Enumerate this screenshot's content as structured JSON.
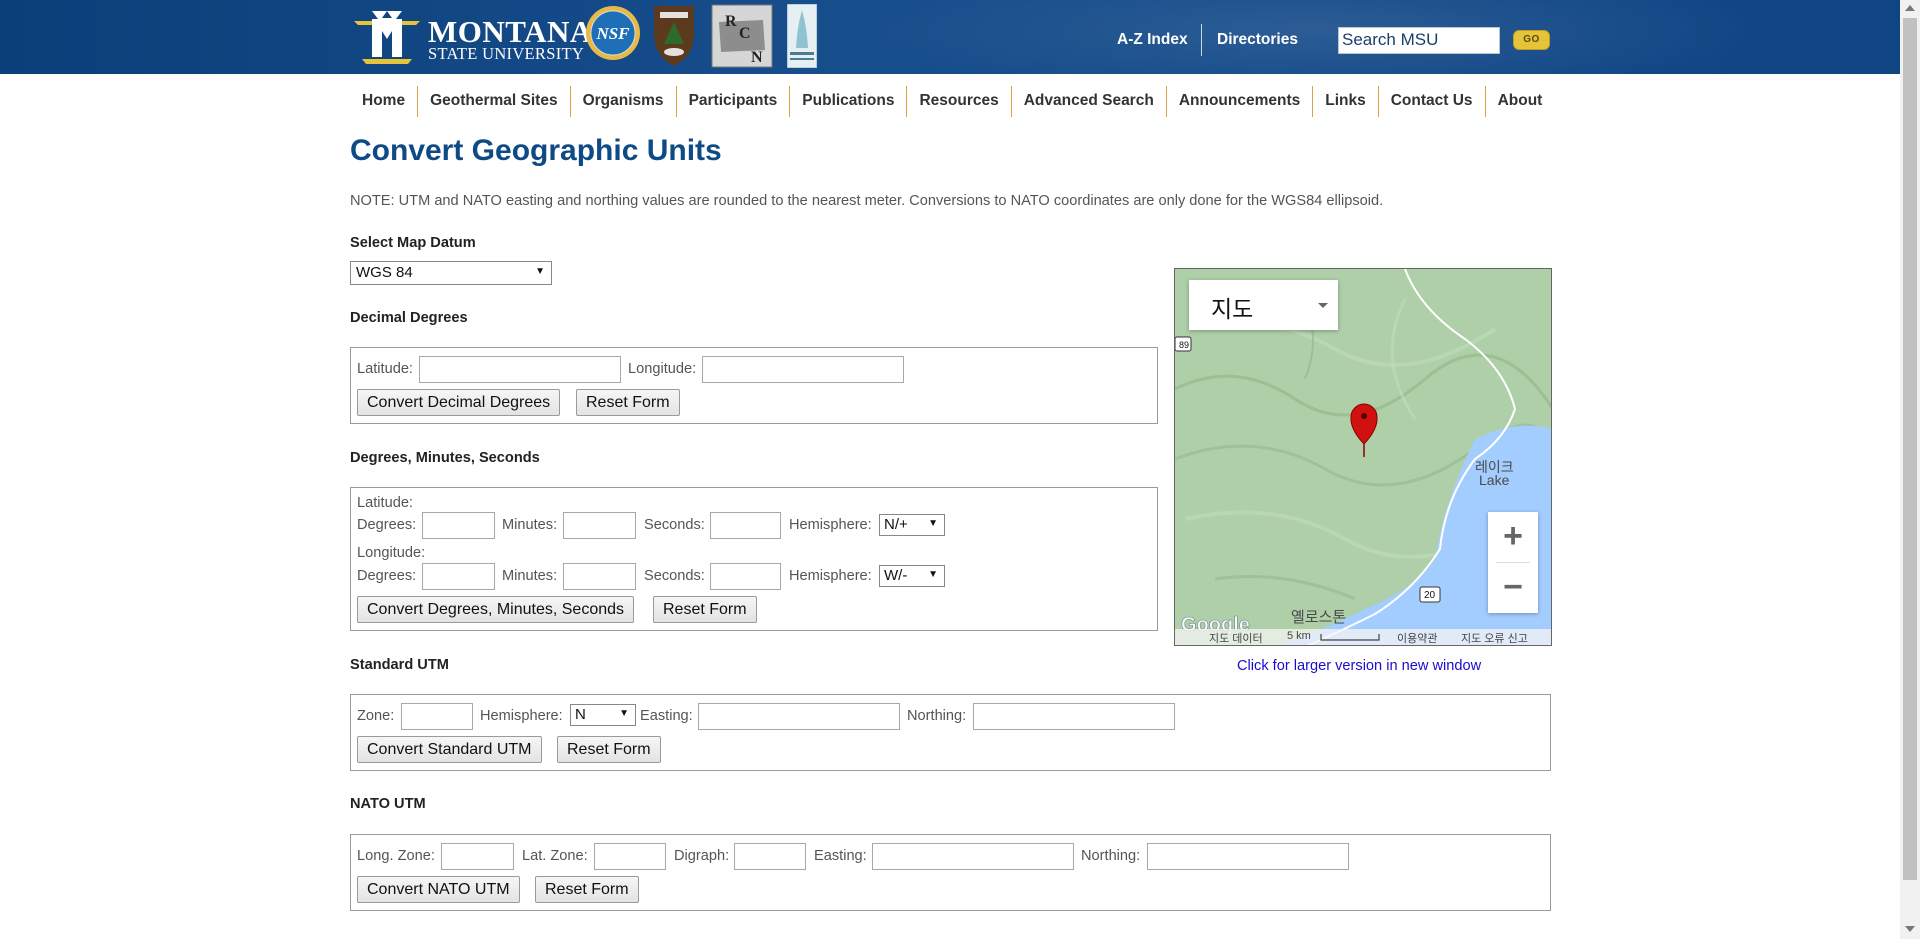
{
  "header": {
    "logo_line1": "MONTANA",
    "logo_line2": "STATE UNIVERSITY",
    "nsf_label": "NSF",
    "links": {
      "az": "A-Z Index",
      "directories": "Directories"
    },
    "search": {
      "value": "Search MSU",
      "go": "GO"
    },
    "colors": {
      "band": "#0b3f7a",
      "gold": "#e5c43a"
    }
  },
  "nav": {
    "items": [
      "Home",
      "Geothermal Sites",
      "Organisms",
      "Participants",
      "Publications",
      "Resources",
      "Advanced Search",
      "Announcements",
      "Links",
      "Contact Us",
      "About"
    ]
  },
  "page": {
    "title": "Convert Geographic Units",
    "note": "NOTE: UTM and NATO easting and northing values are rounded to the nearest meter. Conversions to NATO coordinates are only done for the WGS84 ellipsoid."
  },
  "datum": {
    "label": "Select Map Datum",
    "selected": "WGS 84"
  },
  "decimal": {
    "heading": "Decimal Degrees",
    "latitude_label": "Latitude:",
    "longitude_label": "Longitude:",
    "convert": "Convert Decimal Degrees",
    "reset": "Reset Form"
  },
  "dms": {
    "heading": "Degrees, Minutes, Seconds",
    "latitude_label": "Latitude:",
    "longitude_label": "Longitude:",
    "degrees_label": "Degrees:",
    "minutes_label": "Minutes:",
    "seconds_label": "Seconds:",
    "hemisphere_label": "Hemisphere:",
    "lat_hemisphere": "N/+",
    "lon_hemisphere": "W/-",
    "convert": "Convert Degrees, Minutes, Seconds",
    "reset": "Reset Form"
  },
  "utm": {
    "heading": "Standard UTM",
    "zone_label": "Zone:",
    "hemisphere_label": "Hemisphere:",
    "hemisphere_value": "N",
    "easting_label": "Easting:",
    "northing_label": "Northing:",
    "convert": "Convert Standard UTM",
    "reset": "Reset Form"
  },
  "nato": {
    "heading": "NATO UTM",
    "long_zone_label": "Long. Zone:",
    "lat_zone_label": "Lat. Zone:",
    "digraph_label": "Digraph:",
    "easting_label": "Easting:",
    "northing_label": "Northing:",
    "convert": "Convert NATO UTM",
    "reset": "Reset Form"
  },
  "map": {
    "type": "지도",
    "zoom_in": "+",
    "zoom_out": "−",
    "route_89": "89",
    "route_20": "20",
    "lake_label1": "레이크",
    "lake_label2": "Lake",
    "yellowstone_label": "옐로스톤",
    "footer": {
      "data": "지도 데이터",
      "scale": "5 km",
      "terms": "이용약관",
      "report": "지도 오류 신고"
    },
    "larger_link": "Click for larger version in new window",
    "colors": {
      "land": "#aecfa8",
      "water": "#a3ccff",
      "marker": "#d11010"
    }
  }
}
